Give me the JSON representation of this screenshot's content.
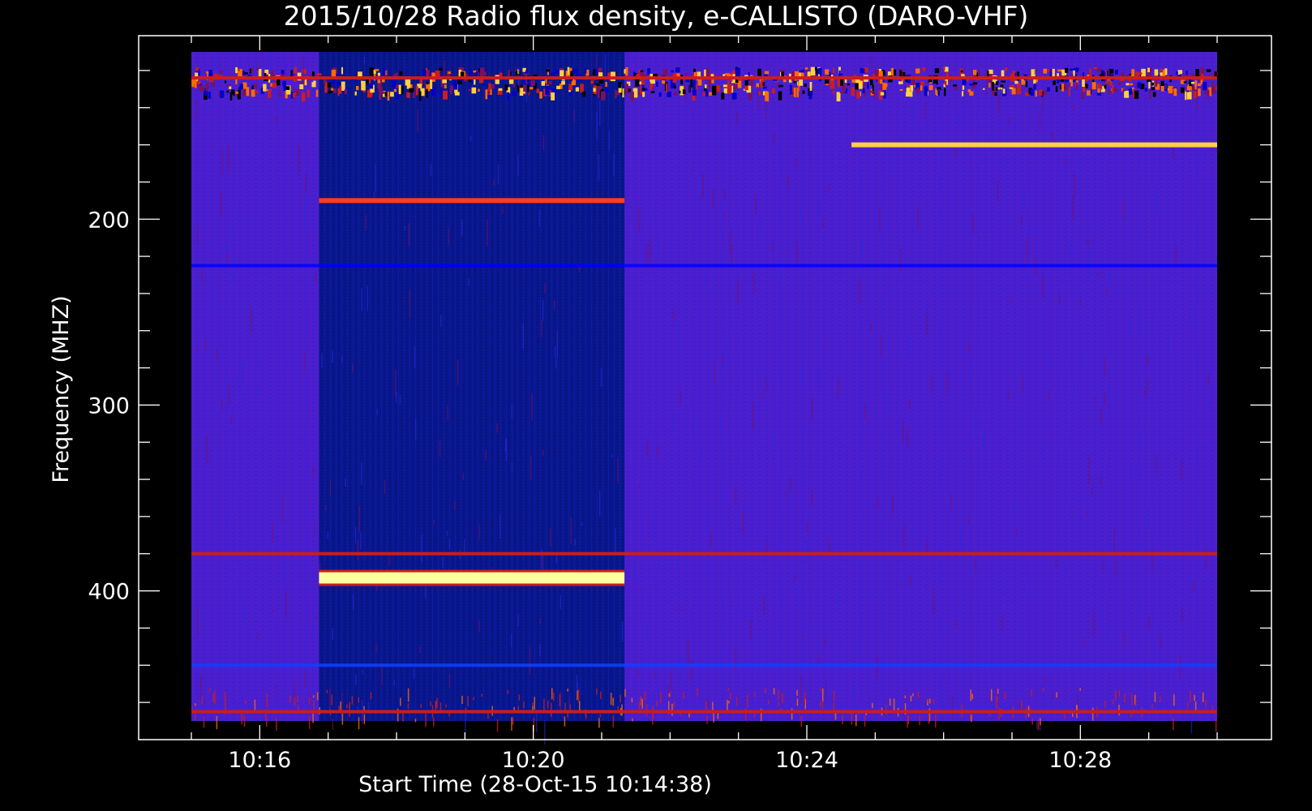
{
  "chart_data": {
    "type": "heatmap",
    "title": "2015/10/28  Radio flux density, e-CALLISTO (DARO-VHF)",
    "xlabel": "Start Time (28-Oct-15 10:14:38)",
    "ylabel": "Frequency (MHZ)",
    "x_range_minutes": [
      "10:15:00",
      "10:30:00"
    ],
    "y_range_mhz": [
      110,
      470
    ],
    "y_inverted": true,
    "x_ticks": [
      {
        "label": "10:16",
        "minutes": 16
      },
      {
        "label": "10:20",
        "minutes": 20
      },
      {
        "label": "10:24",
        "minutes": 24
      },
      {
        "label": "10:28",
        "minutes": 28
      }
    ],
    "y_ticks": [
      {
        "label": "200",
        "mhz": 200
      },
      {
        "label": "300",
        "mhz": 300
      },
      {
        "label": "400",
        "mhz": 400
      }
    ],
    "background_colors": {
      "outer": "#000000",
      "data_region": "#4b1fd0",
      "calibration_region": "#0a168c"
    },
    "colormap": [
      "#000000",
      "#0000c8",
      "#4b1fd0",
      "#7a1060",
      "#c81e1e",
      "#ff6a00",
      "#ffd040",
      "#ffffc0"
    ],
    "segments": [
      {
        "name": "observation",
        "start": "10:15:00",
        "end": "10:16:52"
      },
      {
        "name": "calibration",
        "start": "10:16:52",
        "end": "10:21:20"
      },
      {
        "name": "observation",
        "start": "10:21:20",
        "end": "10:30:00"
      }
    ],
    "bands": [
      {
        "mhz": 124,
        "segment": "all",
        "intensity": "moderate",
        "color": "#c81e1e"
      },
      {
        "mhz": 160,
        "segment": "observation-late",
        "intensity": "high",
        "color": "#ffd040"
      },
      {
        "mhz": 190,
        "segment": "calibration",
        "intensity": "high",
        "color": "#ff3c1e"
      },
      {
        "mhz": 225,
        "segment": "all",
        "intensity": "low",
        "color": "#0000ff"
      },
      {
        "mhz": 380,
        "segment": "all",
        "intensity": "moderate",
        "color": "#c81e1e"
      },
      {
        "mhz": 393,
        "segment": "calibration",
        "intensity": "very high",
        "color": "#ffffa0"
      },
      {
        "mhz": 440,
        "segment": "all",
        "intensity": "low",
        "color": "#1040ff"
      },
      {
        "mhz": 465,
        "segment": "all",
        "intensity": "moderate",
        "color": "#c81e1e"
      }
    ],
    "grid": false,
    "legend": "none"
  }
}
